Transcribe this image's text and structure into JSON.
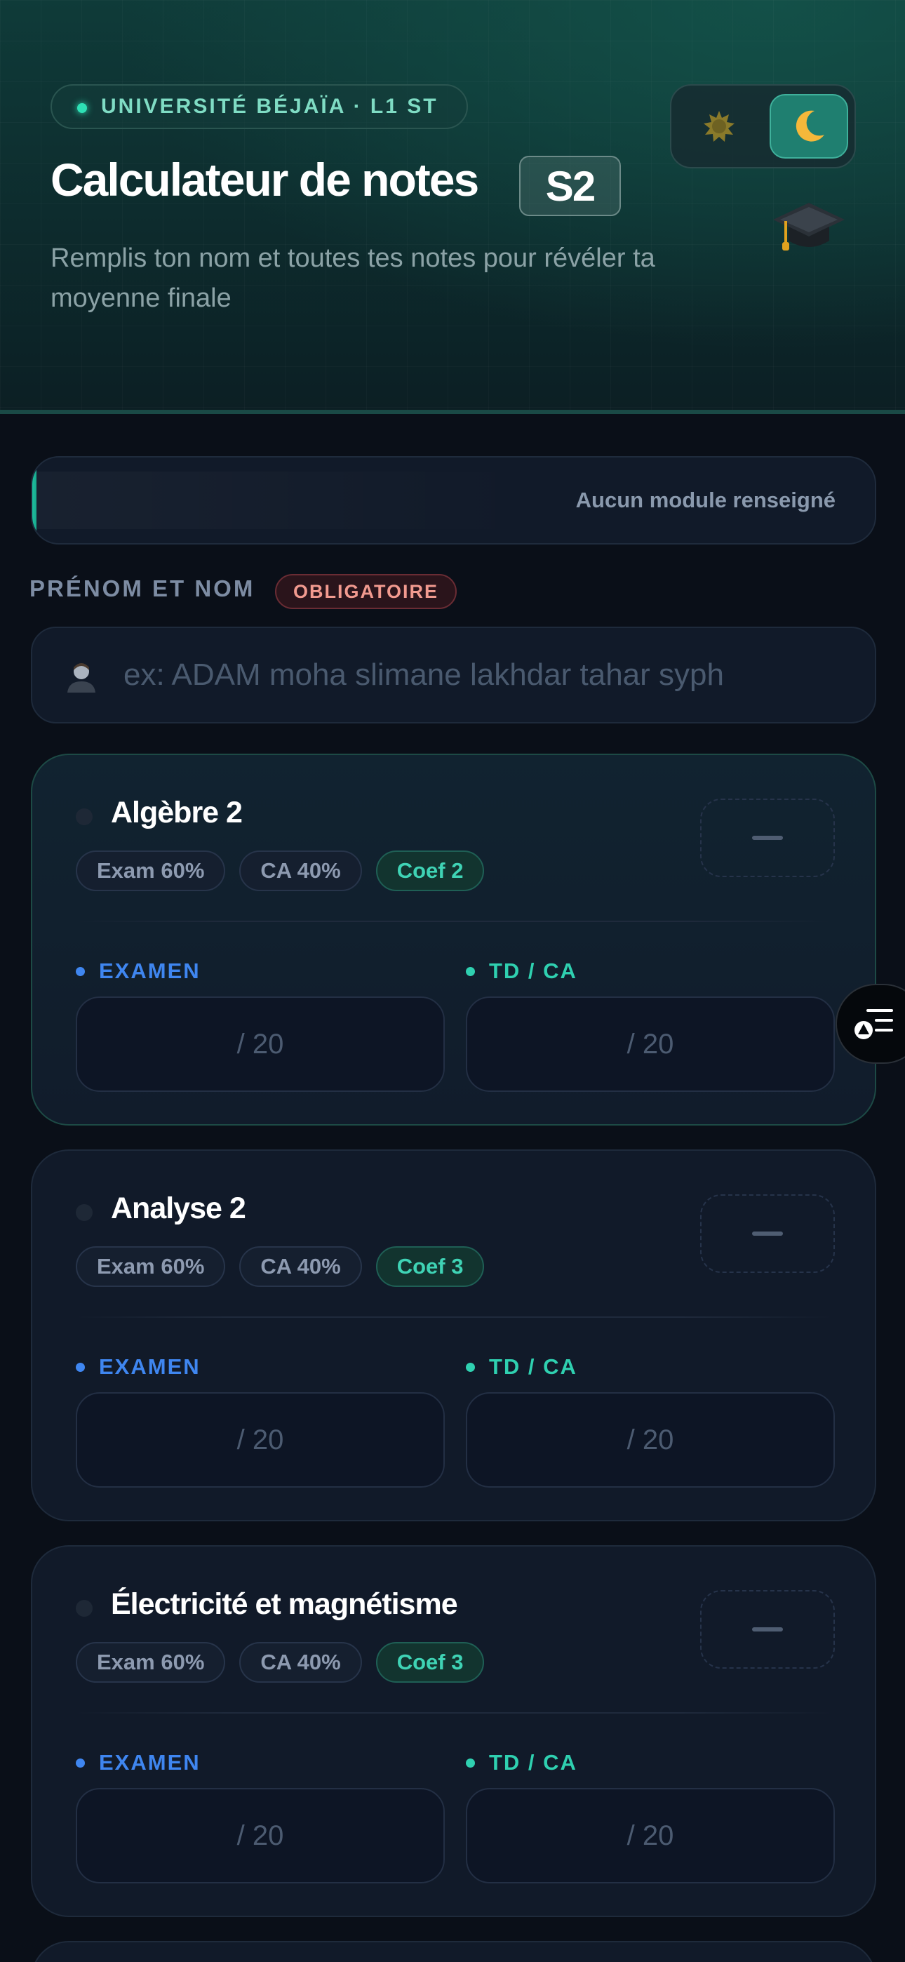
{
  "header": {
    "university": "UNIVERSITÉ BÉJAÏA · L1 ST",
    "title": "Calculateur de notes",
    "semester": "S2",
    "subtitle": "Remplis ton nom et toutes tes notes pour révéler ta moyenne finale",
    "theme": {
      "light_icon": "sun-icon",
      "dark_icon": "moon-icon",
      "active": "dark"
    },
    "decor_icon": "graduation-cap-icon"
  },
  "progress": {
    "text": "Aucun module renseigné",
    "fraction": 0.0
  },
  "name_field": {
    "label": "PRÉNOM ET NOM",
    "required_badge": "OBLIGATOIRE",
    "placeholder": "ex: ADAM moha slimane lakhdar tahar syph",
    "value": "",
    "icon": "person-icon"
  },
  "modules": [
    {
      "name": "Algèbre 2",
      "exam_chip": "Exam 60%",
      "ca_chip": "CA 40%",
      "coef_chip": "Coef 2",
      "exam_label": "EXAMEN",
      "td_label": "TD / CA",
      "exam_placeholder": "/ 20",
      "td_placeholder": "/ 20",
      "result": "—"
    },
    {
      "name": "Analyse 2",
      "exam_chip": "Exam 60%",
      "ca_chip": "CA 40%",
      "coef_chip": "Coef 3",
      "exam_label": "EXAMEN",
      "td_label": "TD / CA",
      "exam_placeholder": "/ 20",
      "td_placeholder": "/ 20",
      "result": "—"
    },
    {
      "name": "Électricité et magnétisme",
      "exam_chip": "Exam 60%",
      "ca_chip": "CA 40%",
      "coef_chip": "Coef 3",
      "exam_label": "EXAMEN",
      "td_label": "TD / CA",
      "exam_placeholder": "/ 20",
      "td_placeholder": "/ 20",
      "result": "—"
    }
  ],
  "fab": {
    "icon": "summary-list-icon"
  },
  "colors": {
    "accent": "#2fd0b0",
    "exam": "#3f86f0",
    "background": "#0a0f18",
    "card": "#111a29",
    "required": "#f19a8f"
  }
}
